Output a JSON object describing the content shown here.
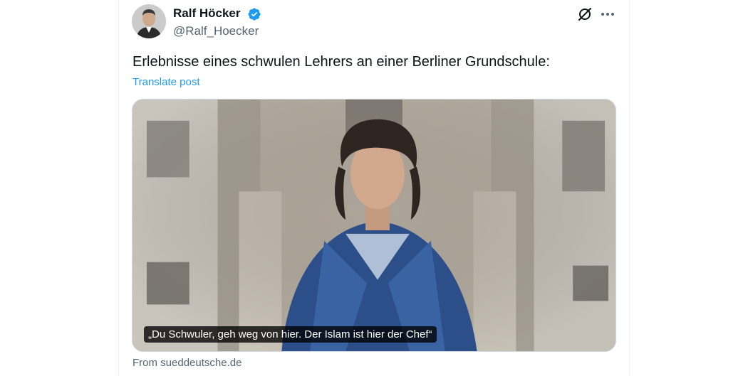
{
  "post": {
    "author": {
      "name": "Ralf Höcker",
      "handle": "@Ralf_Hoecker",
      "verified": true
    },
    "text": "Erlebnisse eines schwulen Lehrers an einer Berliner Grundschule:",
    "translate_label": "Translate post",
    "card": {
      "caption": "„Du Schwuler, geh weg von hier. Der Islam ist hier der Chef“",
      "source": "From sueddeutsche.de"
    }
  },
  "icons": {
    "verified": "verified-badge-icon",
    "grok": "grok-icon",
    "more": "more-icon"
  },
  "colors": {
    "accent": "#1d9bf0",
    "text_primary": "#0f1419",
    "text_secondary": "#536471",
    "border": "#cfd9de"
  }
}
